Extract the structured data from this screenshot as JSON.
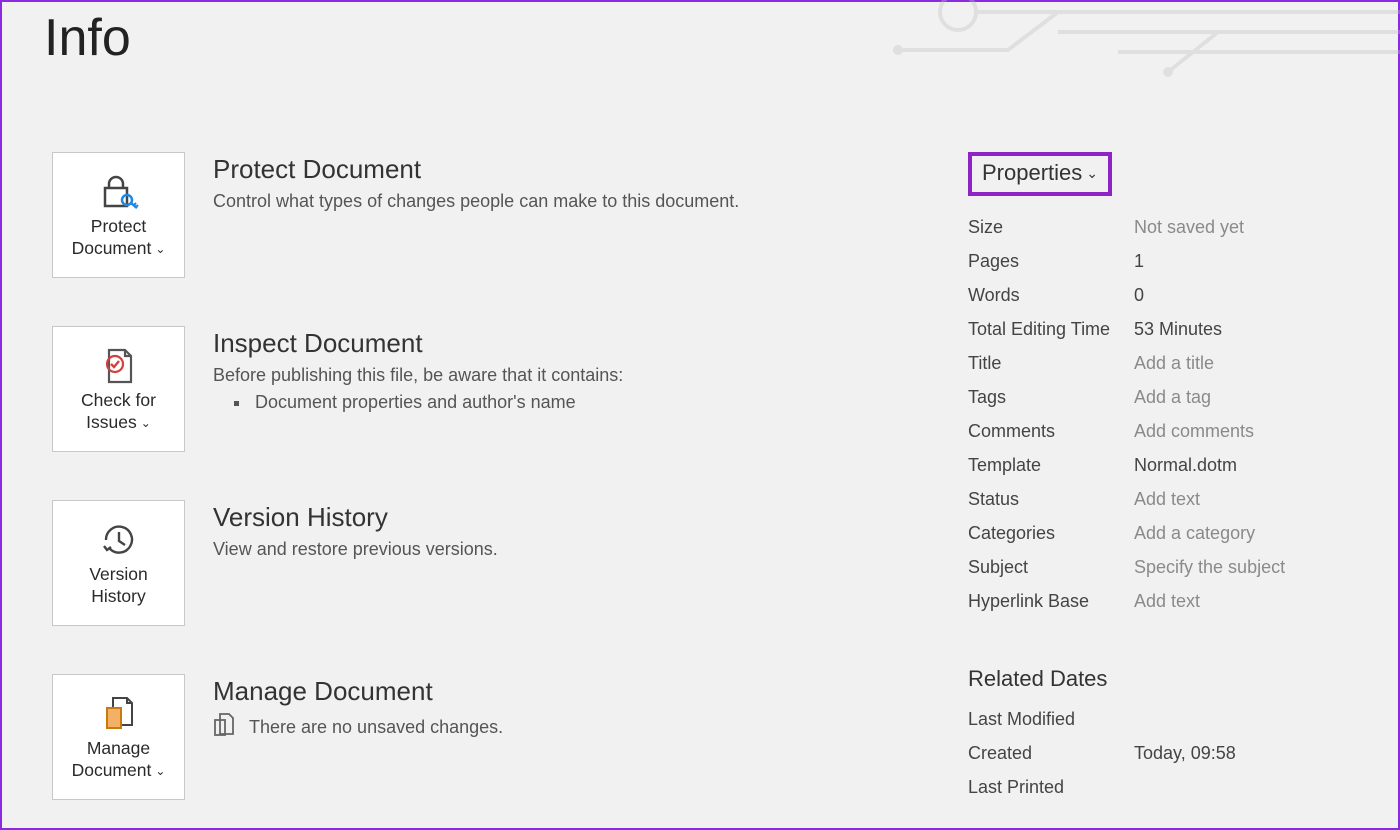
{
  "page": {
    "title": "Info"
  },
  "protect": {
    "title": "Protect Document",
    "desc": "Control what types of changes people can make to this document.",
    "tile_line1": "Protect",
    "tile_line2": "Document"
  },
  "inspect": {
    "title": "Inspect Document",
    "desc": "Before publishing this file, be aware that it contains:",
    "bullet1": "Document properties and author's name",
    "tile_line1": "Check for",
    "tile_line2": "Issues"
  },
  "version": {
    "title": "Version History",
    "desc": "View and restore previous versions.",
    "tile_line1": "Version",
    "tile_line2": "History"
  },
  "manage": {
    "title": "Manage Document",
    "desc": "There are no unsaved changes.",
    "tile_line1": "Manage",
    "tile_line2": "Document"
  },
  "properties": {
    "header": "Properties",
    "rows": [
      {
        "label": "Size",
        "value": "Not saved yet",
        "placeholder": true
      },
      {
        "label": "Pages",
        "value": "1",
        "placeholder": false
      },
      {
        "label": "Words",
        "value": "0",
        "placeholder": false
      },
      {
        "label": "Total Editing Time",
        "value": "53 Minutes",
        "placeholder": false
      },
      {
        "label": "Title",
        "value": "Add a title",
        "placeholder": true
      },
      {
        "label": "Tags",
        "value": "Add a tag",
        "placeholder": true
      },
      {
        "label": "Comments",
        "value": "Add comments",
        "placeholder": true
      },
      {
        "label": "Template",
        "value": "Normal.dotm",
        "placeholder": false
      },
      {
        "label": "Status",
        "value": "Add text",
        "placeholder": true
      },
      {
        "label": "Categories",
        "value": "Add a category",
        "placeholder": true
      },
      {
        "label": "Subject",
        "value": "Specify the subject",
        "placeholder": true
      },
      {
        "label": "Hyperlink Base",
        "value": "Add text",
        "placeholder": true
      }
    ]
  },
  "related_dates": {
    "header": "Related Dates",
    "rows": [
      {
        "label": "Last Modified",
        "value": ""
      },
      {
        "label": "Created",
        "value": "Today, 09:58"
      },
      {
        "label": "Last Printed",
        "value": ""
      }
    ]
  }
}
